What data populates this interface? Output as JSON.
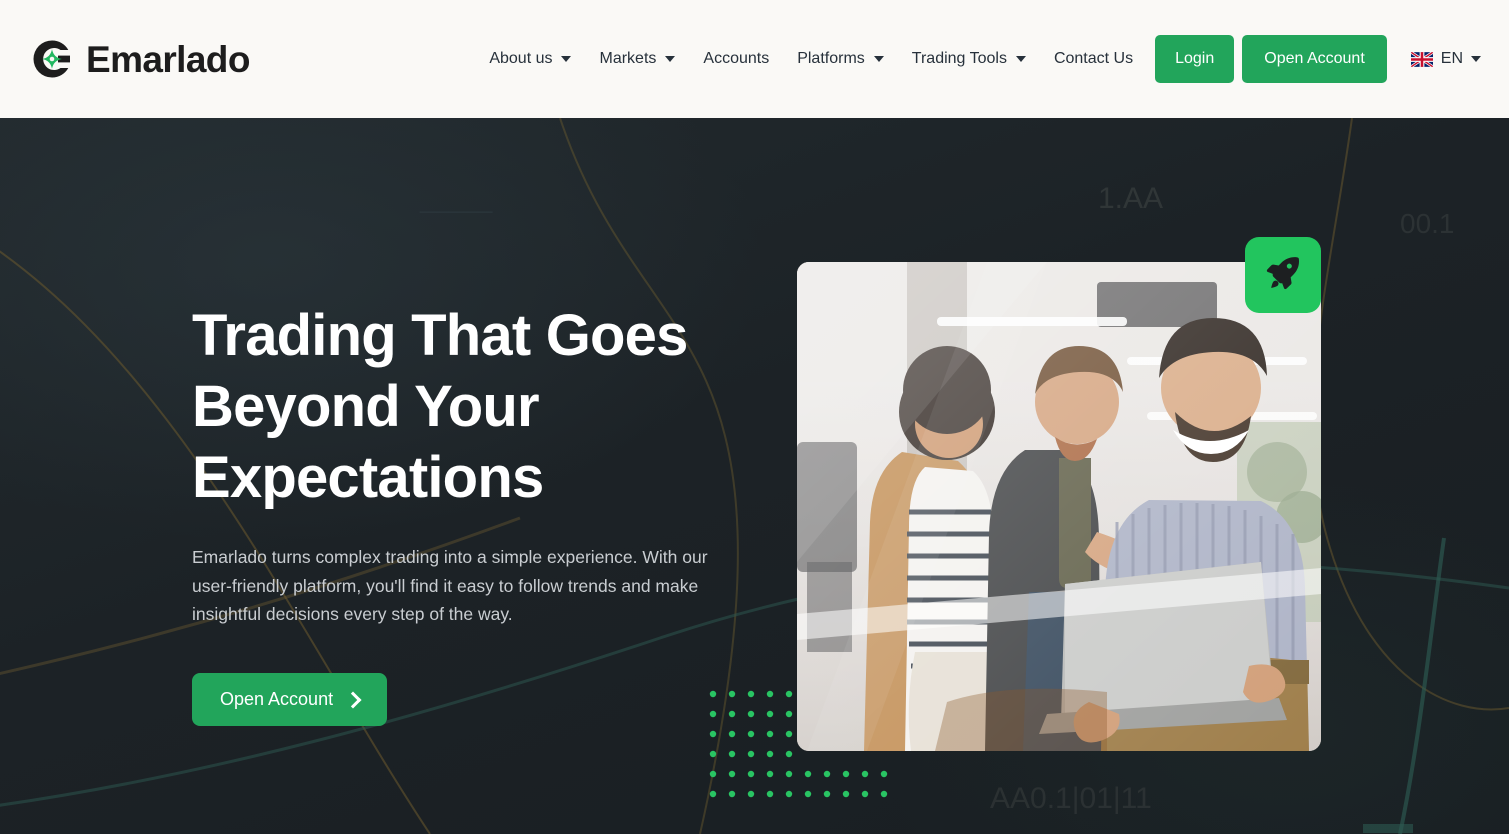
{
  "brand": {
    "name": "Emarlado",
    "logo_icon": "emarlado-target-logo"
  },
  "nav": {
    "items": [
      {
        "label": "About us",
        "has_dropdown": true,
        "icon": "chevron-down-icon"
      },
      {
        "label": "Markets",
        "has_dropdown": true,
        "icon": "chevron-down-icon"
      },
      {
        "label": "Accounts",
        "has_dropdown": false,
        "icon": ""
      },
      {
        "label": "Platforms",
        "has_dropdown": true,
        "icon": "chevron-down-icon"
      },
      {
        "label": "Trading Tools",
        "has_dropdown": true,
        "icon": "chevron-down-icon"
      },
      {
        "label": "Contact Us",
        "has_dropdown": false,
        "icon": ""
      }
    ],
    "login_label": "Login",
    "open_account_label": "Open Account",
    "language": {
      "code": "EN",
      "flag_icon": "uk-flag-icon",
      "caret_icon": "chevron-down-icon"
    }
  },
  "hero": {
    "title_line_1": "Trading That Goes",
    "title_line_2": "Beyond Your",
    "title_line_3": "Expectations",
    "subtitle": "Emarlado turns complex trading into a simple experience. With our user-friendly platform, you'll find it easy to follow trends and make insightful decisions every step of the way.",
    "cta_label": "Open Account",
    "cta_icon": "chevron-right-icon",
    "badge_icon": "rocket-icon",
    "photo_alt": "Three colleagues smiling at a laptop in a modern office",
    "decor": {
      "dot_grid_icon": "green-dot-grid",
      "ticker_label_1": "1.AA",
      "ticker_label_2": "00.1",
      "ticker_label_3": "AA0.1|01|11"
    }
  },
  "colors": {
    "brand_green": "#22a55b",
    "badge_green": "#22c55e",
    "header_bg": "#faf9f6",
    "hero_bg": "#1e2428",
    "heading_text": "#ffffff",
    "body_text": "#c9cdd1",
    "dot_green": "#29c463"
  }
}
